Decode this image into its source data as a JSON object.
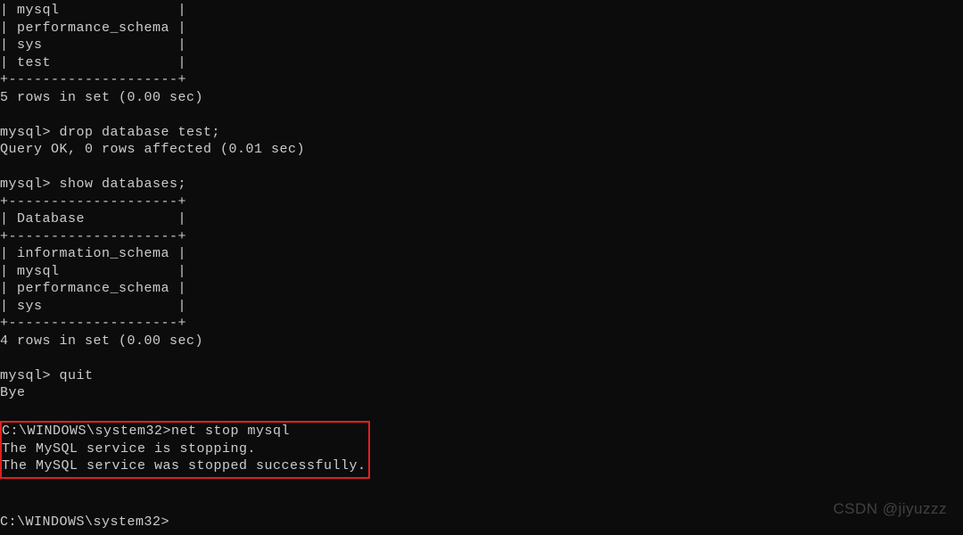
{
  "terminal": {
    "lines": {
      "row_mysql": "| mysql              |",
      "row_perf": "| performance_schema |",
      "row_sys": "| sys                |",
      "row_test": "| test               |",
      "border": "+--------------------+",
      "result5": "5 rows in set (0.00 sec)",
      "blank": "",
      "prompt_drop": "mysql> drop database test;",
      "query_ok": "Query OK, 0 rows affected (0.01 sec)",
      "prompt_show": "mysql> show databases;",
      "header_db": "| Database           |",
      "row_info": "| information_schema |",
      "result4": "4 rows in set (0.00 sec)",
      "prompt_quit": "mysql> quit",
      "bye": "Bye",
      "cmd_netstop": "C:\\WINDOWS\\system32>net stop mysql",
      "svc_stopping": "The MySQL service is stopping.",
      "svc_stopped": "The MySQL service was stopped successfully.",
      "prompt_sys": "C:\\WINDOWS\\system32>"
    }
  },
  "watermark": "CSDN @jiyuzzz"
}
